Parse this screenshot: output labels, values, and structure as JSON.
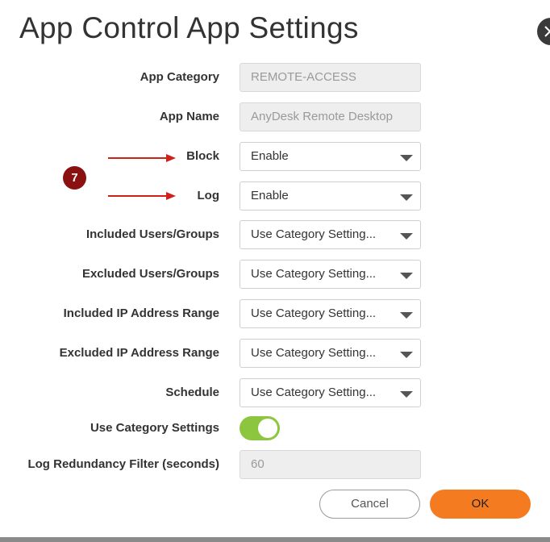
{
  "dialog": {
    "title": "App Control App Settings",
    "close_icon": "close-icon"
  },
  "fields": {
    "app_category": {
      "label": "App Category",
      "value": "REMOTE-ACCESS"
    },
    "app_name": {
      "label": "App Name",
      "value": "AnyDesk Remote Desktop"
    },
    "block": {
      "label": "Block",
      "value": "Enable"
    },
    "log": {
      "label": "Log",
      "value": "Enable"
    },
    "included_users": {
      "label": "Included Users/Groups",
      "value": "Use Category Setting..."
    },
    "excluded_users": {
      "label": "Excluded Users/Groups",
      "value": "Use Category Setting..."
    },
    "included_ip": {
      "label": "Included IP Address Range",
      "value": "Use Category Setting..."
    },
    "excluded_ip": {
      "label": "Excluded IP Address Range",
      "value": "Use Category Setting..."
    },
    "schedule": {
      "label": "Schedule",
      "value": "Use Category Setting..."
    },
    "use_category_settings": {
      "label": "Use Category Settings",
      "on": true
    },
    "log_redundancy": {
      "label": "Log Redundancy Filter (seconds)",
      "value": "60"
    }
  },
  "annotation": {
    "badge_number": "7",
    "arrow_color": "#d0201a",
    "badge_color": "#8b1010"
  },
  "buttons": {
    "cancel": "Cancel",
    "ok": "OK"
  },
  "colors": {
    "accent": "#f47b20",
    "toggle_on": "#8cc63f"
  }
}
